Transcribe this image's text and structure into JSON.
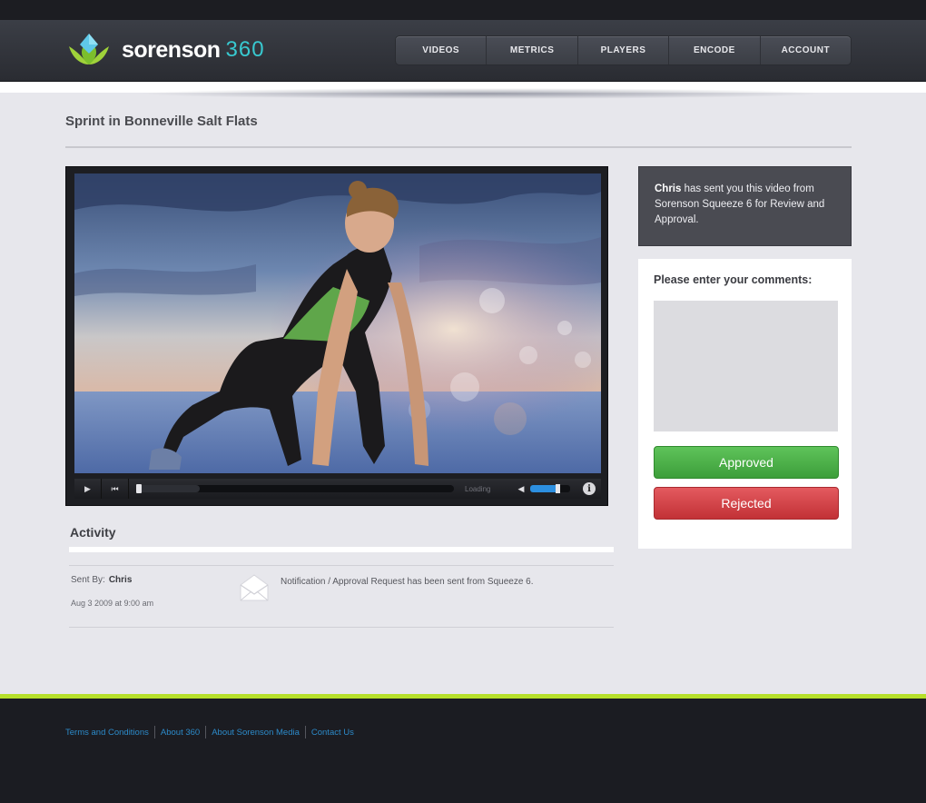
{
  "header": {
    "logo_word": "sorenson",
    "logo_number": "360",
    "nav": [
      "VIDEOS",
      "METRICS",
      "PLAYERS",
      "ENCODE",
      "ACCOUNT"
    ]
  },
  "page": {
    "title": "Sprint in Bonneville Salt Flats"
  },
  "player": {
    "status": "Loading",
    "progress": 0.2,
    "volume": 0.75
  },
  "activity": {
    "title": "Activity",
    "sent_by_label": "Sent By:",
    "sender": "Chris",
    "date": "Aug 3 2009 at 9:00 am",
    "message": "Notification / Approval Request has been sent from Squeeze 6."
  },
  "sidebar": {
    "notice_name": "Chris",
    "notice_text": " has sent you this video from Sorenson Squeeze 6 for Review and Approval.",
    "comments_label": "Please enter your comments:",
    "approve_label": "Approved",
    "reject_label": "Rejected"
  },
  "footer": {
    "links": [
      "Terms and Conditions",
      "About 360",
      "About Sorenson Media",
      "Contact Us"
    ]
  },
  "colors": {
    "accent": "#38c9d0",
    "approve": "#4cae48",
    "reject": "#d1444a",
    "footer_line": "#b6e02a",
    "link": "#2c8ac9"
  }
}
